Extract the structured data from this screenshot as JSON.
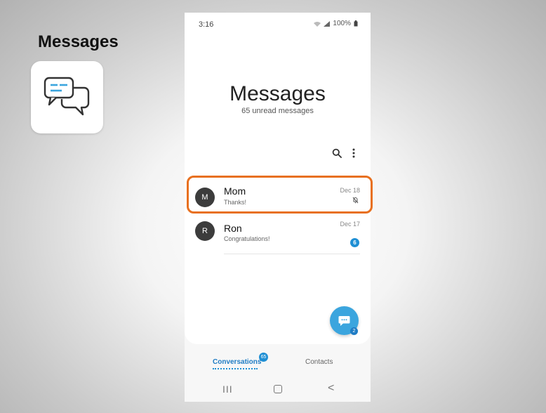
{
  "lesson": {
    "title": "Messages",
    "tile_icon": "chat-bubbles-icon"
  },
  "status_bar": {
    "time": "3:16",
    "battery": "100%",
    "icons": [
      "wifi-icon",
      "signal-icon",
      "battery-icon"
    ]
  },
  "app": {
    "title": "Messages",
    "unread_text": "65 unread messages"
  },
  "toolbar": {
    "icons": [
      "search-icon",
      "more-options-icon"
    ]
  },
  "conversations": [
    {
      "avatar_letter": "M",
      "name": "Mom",
      "snippet": "Thanks!",
      "date": "Dec 18",
      "status_icon": "muted-bell-icon",
      "highlighted": true
    },
    {
      "avatar_letter": "R",
      "name": "Ron",
      "snippet": "Congratulations!",
      "date": "Dec 17",
      "unread_count": "6"
    }
  ],
  "fab": {
    "icon": "new-message-icon",
    "badge": "2"
  },
  "tabs": {
    "conversations": "Conversations",
    "conversations_badge": "65",
    "contacts": "Contacts",
    "selected": "conversations"
  },
  "nav": {
    "recent_glyph": "III",
    "back_glyph": "<"
  },
  "colors": {
    "accent": "#1f8fd4",
    "highlight": "#e8701f",
    "avatar": "#3c3c3c",
    "fab": "#3ba5de"
  }
}
